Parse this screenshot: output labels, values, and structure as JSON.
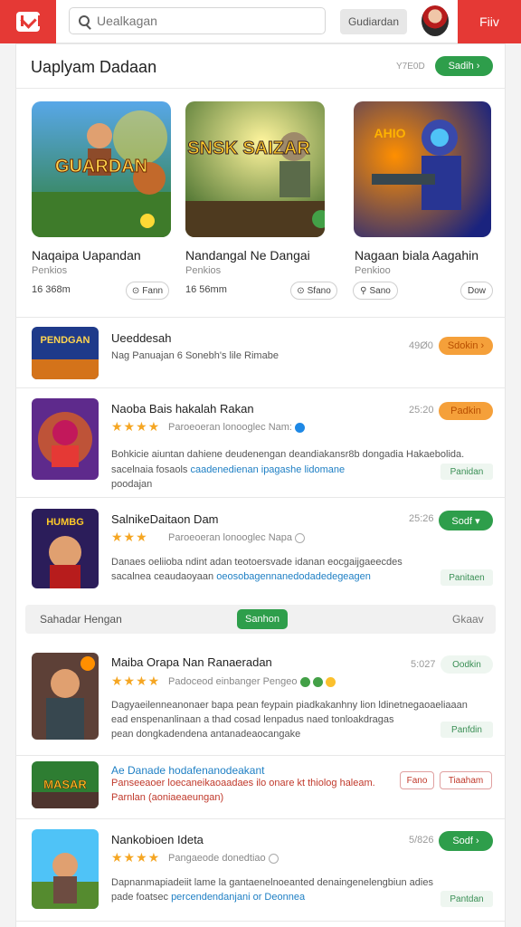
{
  "header": {
    "search_placeholder": "Uealkagan",
    "filter_label": "Gudiardan",
    "action_label": "Fiiv"
  },
  "featured": {
    "title": "Uaplyam Dadaan",
    "meta": "Y7E0D",
    "see_all_label": "Sadih ›",
    "games": [
      {
        "art_text": "GUARDAN",
        "name": "Naqaipa Uapandan",
        "sub": "Penkios",
        "size": "16 368m",
        "btn": "Fann"
      },
      {
        "art_text": "SNSK SAIZAR",
        "name": "Nandangal Ne Dangai",
        "sub": "Penkios",
        "size": "16 56mm",
        "btn": "Sfano"
      },
      {
        "art_text": "AHIO",
        "name": "Nagaan biala Aagahin",
        "sub": "Penkioo",
        "size": "",
        "btn": "Sano",
        "btn2": "Dow"
      }
    ]
  },
  "list1": [
    {
      "art_text": "PENDGAN",
      "title": "Ueeddesah",
      "desc": "Nag Panuajan 6 Sonebh's lile Rimabe",
      "time": "49Ø0",
      "btn": "Sdokin ›"
    },
    {
      "art_text": "",
      "title": "Naoba Bais hakalah Rakan",
      "stars": "★★★★",
      "meta": "Paroeoeran lonooglec Nam:",
      "desc1": "Bohkicie aiuntan dahiene deudenengan deandiakansr8b dongadia Hakaebolida.",
      "desc2a": "sacelnaia fosaols ",
      "desc2b": "caadenedienan ipagashe lidomane",
      "desc3": "poodajan",
      "time": "25:20",
      "btn": "Padkin",
      "ghost": "Panidan"
    },
    {
      "art_text": "HUMBG",
      "title": "SalnikeDaitaon Dam",
      "stars": "★★★",
      "meta": "Paroeoeran lonooglec Napa",
      "desc1": "Danaes oeliioba ndint adan teotoersvade idanan eocgaijgaeecdes",
      "desc2a": "sacalnea ceaudaoyaan ",
      "desc2b": "oeosobagennanedodadedegeagen",
      "time": "25:26",
      "btn": "Sodf ▾",
      "ghost": "Panitaen"
    }
  ],
  "filter": {
    "left": "Sahadar Hengan",
    "center": "Sanhon",
    "right": "Gkaav"
  },
  "list2": [
    {
      "title": "Maiba Orapa Nan Ranaeradan",
      "stars": "★★★★",
      "meta": "Padoceod einbanger Pengeo",
      "desc1": "Dagyaeilenneanonaer bapa pean feypain piadkakanhny lion ldinetnegaoaeliaaan",
      "desc2": "ead enspenanlinaan a thad cosad lenpadus naed tonloakdragas",
      "desc3": "pean dongkadendena antanadeaocangake",
      "time": "5:027",
      "btn": "Oodkin",
      "ghost": "Panfdin"
    },
    {
      "art_text": "MASAR",
      "title": "Ae Danade hodafenanodeakant",
      "desc1": "Panseeaoer loecaneikaoaadaes ilo onare kt thiolog haleam.",
      "desc2": "Parnlan (aoniaeaeungan)",
      "btn": "Fano",
      "btn2": "Tiaaham"
    },
    {
      "title": "Nankobioen Ideta",
      "stars": "★★★★",
      "meta": "Pangaeode donedtiao",
      "desc1": "Dapnanmapiadeiit lame la gantaenelnoeanted denaingenelengbiun adies",
      "desc2a": "pade foatsec ",
      "desc2b": "percendendanjani or Deonnea",
      "time": "5/826",
      "btn": "Sodf ›",
      "ghost": "Pantdan"
    }
  ],
  "colors": {
    "brand_red": "#e53935",
    "accent_green": "#2e9e4b",
    "accent_orange": "#f5a03a",
    "star": "#f5a623"
  }
}
